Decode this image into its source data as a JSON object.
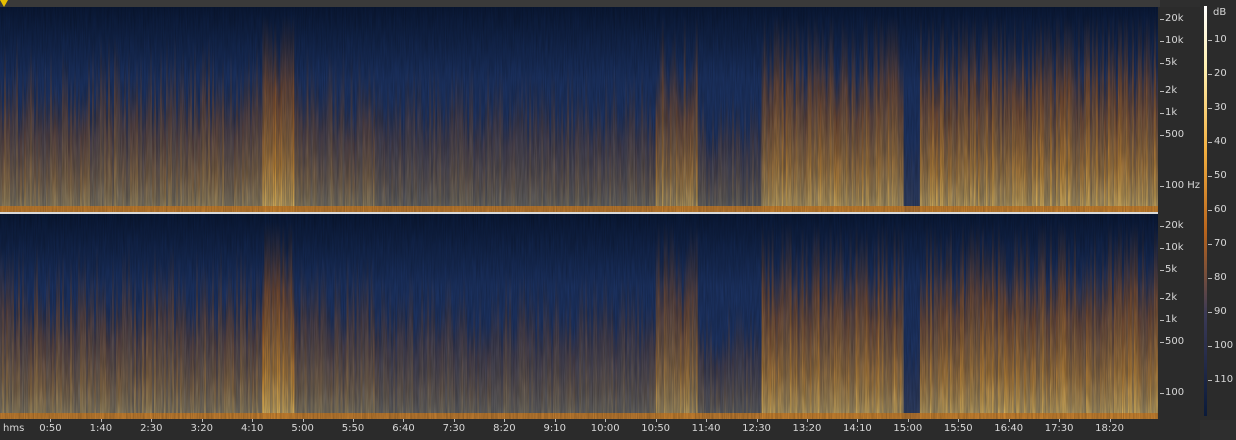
{
  "time_axis": {
    "unit_label": "hms",
    "ticks": [
      "0:50",
      "1:40",
      "2:30",
      "3:20",
      "4:10",
      "5:00",
      "5:50",
      "6:40",
      "7:30",
      "8:20",
      "9:10",
      "10:00",
      "10:50",
      "11:40",
      "12:30",
      "13:20",
      "14:10",
      "15:00",
      "15:50",
      "16:40",
      "17:30",
      "18:20"
    ]
  },
  "freq_axis": {
    "upper": [
      "20k",
      "10k",
      "5k",
      "2k",
      "1k",
      "500",
      "100 Hz"
    ],
    "lower": [
      "20k",
      "10k",
      "5k",
      "2k",
      "1k",
      "500",
      "100"
    ]
  },
  "db_scale": {
    "unit_label": "dB",
    "ticks": [
      "10",
      "20",
      "30",
      "40",
      "50",
      "60",
      "70",
      "80",
      "90",
      "100",
      "110"
    ]
  },
  "colors": {
    "background": "#2e2e2e",
    "quiet": "#0a1a3a",
    "mid": "#1d3568",
    "warm": "#b8641c",
    "loud": "#f3b040",
    "peak": "#fff0b0"
  },
  "chart_data": {
    "type": "heatmap",
    "title": "",
    "xlabel": "hms",
    "ylabel": "",
    "channels": 2,
    "x_ticks": [
      "0:50",
      "1:40",
      "2:30",
      "3:20",
      "4:10",
      "5:00",
      "5:50",
      "6:40",
      "7:30",
      "8:20",
      "9:10",
      "10:00",
      "10:50",
      "11:40",
      "12:30",
      "13:20",
      "14:10",
      "15:00",
      "15:50",
      "16:40",
      "17:30",
      "18:20"
    ],
    "y_ticks": [
      "20k",
      "10k",
      "5k",
      "2k",
      "1k",
      "500",
      "100 Hz"
    ],
    "color_scale_ticks_db": [
      10,
      20,
      30,
      40,
      50,
      60,
      70,
      80,
      90,
      100,
      110
    ],
    "segments": [
      {
        "start_s": 0,
        "end_s": 260,
        "intensity": 0.62,
        "top_khz": 4
      },
      {
        "start_s": 260,
        "end_s": 290,
        "intensity": 0.95,
        "top_khz": 20
      },
      {
        "start_s": 290,
        "end_s": 370,
        "intensity": 0.55,
        "top_khz": 3
      },
      {
        "start_s": 370,
        "end_s": 650,
        "intensity": 0.45,
        "top_khz": 2
      },
      {
        "start_s": 650,
        "end_s": 690,
        "intensity": 0.78,
        "top_khz": 10
      },
      {
        "start_s": 690,
        "end_s": 755,
        "intensity": 0.4,
        "top_khz": 1
      },
      {
        "start_s": 755,
        "end_s": 895,
        "intensity": 0.88,
        "top_khz": 12
      },
      {
        "start_s": 895,
        "end_s": 912,
        "intensity": 0.1,
        "top_khz": 0.5
      },
      {
        "start_s": 912,
        "end_s": 1150,
        "intensity": 0.9,
        "top_khz": 14
      }
    ]
  }
}
